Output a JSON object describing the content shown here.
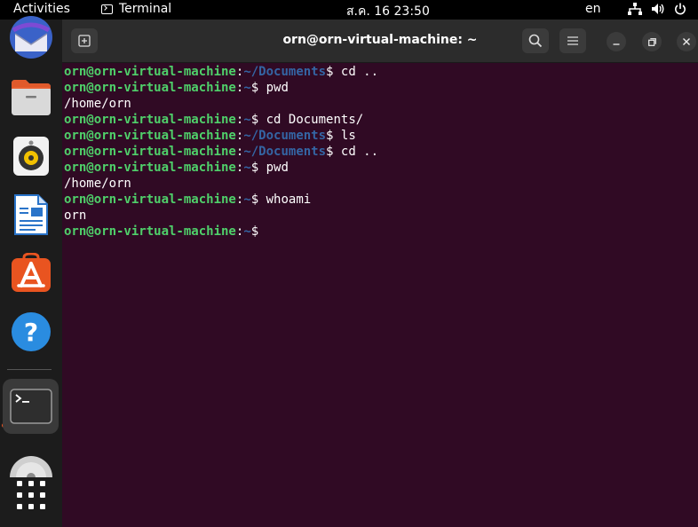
{
  "topbar": {
    "activities": "Activities",
    "app_name": "Terminal",
    "clock": "ส.ค. 16  23:50",
    "lang": "en"
  },
  "dock": {
    "items": [
      {
        "name": "thunderbird-icon"
      },
      {
        "name": "files-icon"
      },
      {
        "name": "rhythmbox-icon"
      },
      {
        "name": "libreoffice-writer-icon"
      },
      {
        "name": "app-center-icon"
      },
      {
        "name": "help-icon"
      },
      {
        "name": "terminal-icon"
      },
      {
        "name": "disc-icon"
      },
      {
        "name": "show-apps-icon"
      }
    ]
  },
  "window": {
    "title": "orn@orn-virtual-machine: ~"
  },
  "terminal": {
    "lines": [
      {
        "user": "orn@orn-virtual-machine",
        "sep": ":",
        "path": "~/Documents",
        "cmd": "$ cd .."
      },
      {
        "user": "orn@orn-virtual-machine",
        "sep": ":",
        "path": "~",
        "cmd": "$ pwd"
      },
      {
        "text": "/home/orn"
      },
      {
        "user": "orn@orn-virtual-machine",
        "sep": ":",
        "path": "~",
        "cmd": "$ cd Documents/"
      },
      {
        "user": "orn@orn-virtual-machine",
        "sep": ":",
        "path": "~/Documents",
        "cmd": "$ ls"
      },
      {
        "user": "orn@orn-virtual-machine",
        "sep": ":",
        "path": "~/Documents",
        "cmd": "$ cd .."
      },
      {
        "user": "orn@orn-virtual-machine",
        "sep": ":",
        "path": "~",
        "cmd": "$ pwd"
      },
      {
        "text": "/home/orn"
      },
      {
        "user": "orn@orn-virtual-machine",
        "sep": ":",
        "path": "~",
        "cmd": "$ whoami"
      },
      {
        "text": "orn"
      },
      {
        "user": "orn@orn-virtual-machine",
        "sep": ":",
        "path": "~",
        "cmd": "$ "
      }
    ]
  },
  "colors": {
    "terminal_bg": "#300a24",
    "prompt_user": "#4fd06a",
    "prompt_path": "#3465a4",
    "accent": "#e95420"
  }
}
